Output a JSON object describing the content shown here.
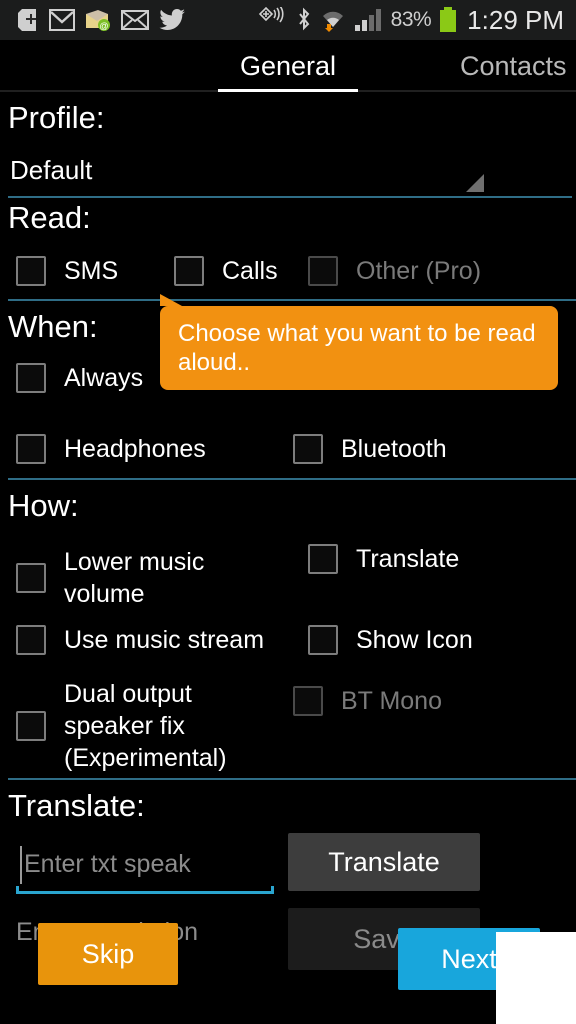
{
  "statusbar": {
    "icons_left": [
      {
        "name": "google-plus-icon",
        "glyph": "+"
      },
      {
        "name": "gmail-icon",
        "glyph": "M"
      },
      {
        "name": "mail-badge-icon",
        "glyph": "✉"
      },
      {
        "name": "email-icon",
        "glyph": "✉"
      },
      {
        "name": "twitter-icon",
        "glyph": "🐦"
      }
    ],
    "icons_right": [
      {
        "name": "nfc-cast-icon",
        "glyph": "((+))"
      },
      {
        "name": "bluetooth-icon",
        "glyph": "ᛒ"
      },
      {
        "name": "wifi-download-icon",
        "glyph": "wifi"
      },
      {
        "name": "cellular-signal-icon",
        "glyph": "bars"
      }
    ],
    "battery_percent": "83%",
    "battery_color": "#8bc916",
    "clock": "1:29 PM"
  },
  "tabs": [
    {
      "label": "General",
      "selected": true
    },
    {
      "label": "Contacts",
      "selected": false
    }
  ],
  "sections": {
    "profile": {
      "title": "Profile:",
      "spinner_value": "Default"
    },
    "read": {
      "title": "Read:",
      "items": [
        {
          "label": "SMS",
          "checked": false,
          "disabled": false
        },
        {
          "label": "Calls",
          "checked": false,
          "disabled": false
        },
        {
          "label": "Other (Pro)",
          "checked": false,
          "disabled": true
        }
      ]
    },
    "when": {
      "title": "When:",
      "items": [
        {
          "label": "Always",
          "checked": false,
          "disabled": false
        },
        {
          "label": "Headphones",
          "checked": false,
          "disabled": false
        },
        {
          "label": "Bluetooth",
          "checked": false,
          "disabled": false
        }
      ]
    },
    "how": {
      "title": "How:",
      "items": [
        {
          "label": "Lower music\nvolume",
          "checked": false,
          "disabled": false
        },
        {
          "label": "Translate",
          "checked": false,
          "disabled": false
        },
        {
          "label": "Use music stream",
          "checked": false,
          "disabled": false
        },
        {
          "label": "Show Icon",
          "checked": false,
          "disabled": false
        },
        {
          "label": "Dual output\nspeaker fix\n(Experimental)",
          "checked": false,
          "disabled": false
        },
        {
          "label": "BT Mono",
          "checked": false,
          "disabled": true
        }
      ]
    },
    "translate": {
      "title": "Translate:",
      "input_value": "",
      "input_placeholder": "Enter txt speak",
      "translate_button": "Translate",
      "second_line_text": "Enter translation",
      "save_button": "Save"
    }
  },
  "tooltip": {
    "text": "Choose what you want to be read aloud..",
    "background": "#f29111"
  },
  "wizard": {
    "skip_label": "Skip",
    "skip_color": "#e8940c",
    "next_label": "Next",
    "next_color": "#18a6dc"
  },
  "labels": {
    "how_lower_music_line1": "Lower music",
    "how_lower_music_line2": "volume",
    "how_dual_line1": "Dual output",
    "how_dual_line2": "speaker fix",
    "how_dual_line3": "(Experimental)"
  },
  "colors": {
    "divider": "#2f6d86",
    "accent_blue": "#2aa5cf",
    "accent_orange": "#e8940c"
  }
}
